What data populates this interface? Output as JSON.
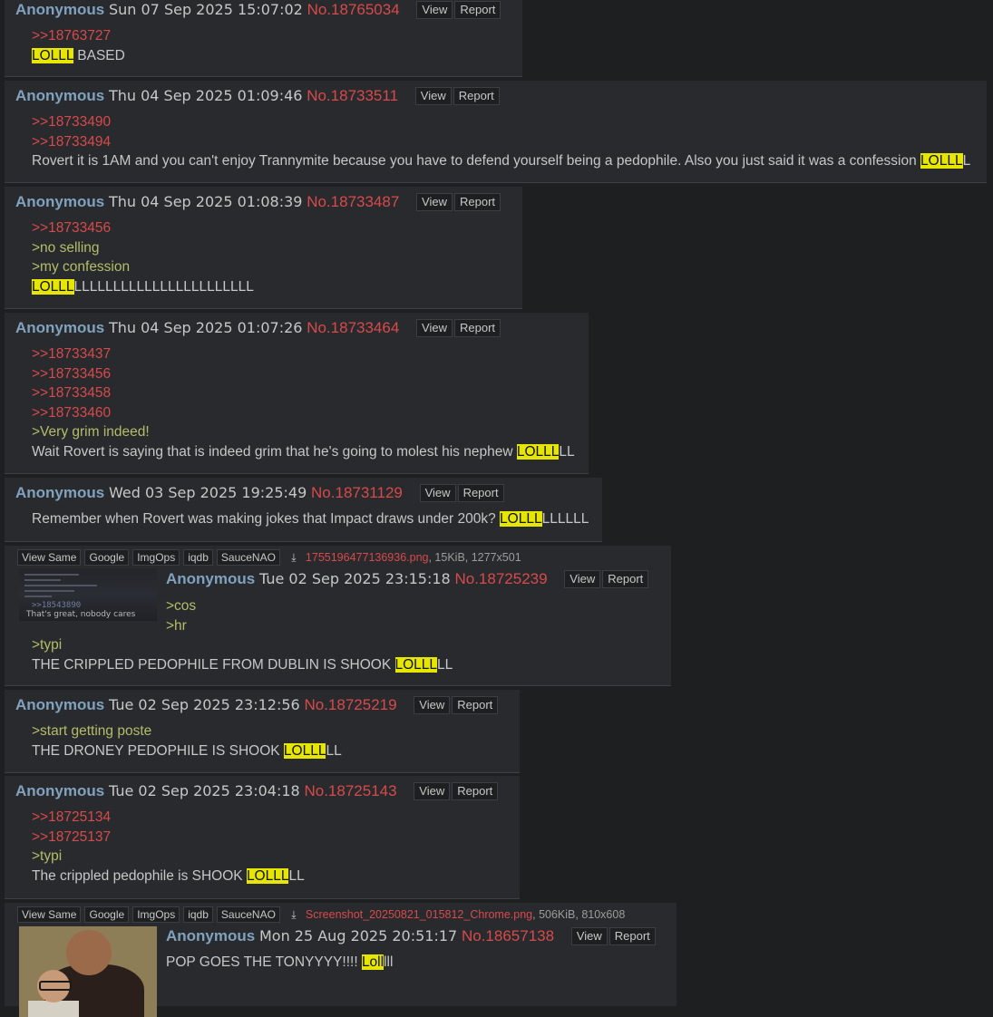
{
  "buttons": {
    "view": "View",
    "report": "Report"
  },
  "file_buttons": [
    "View Same",
    "Google",
    "ImgOps",
    "iqdb",
    "SauceNAO"
  ],
  "posts": [
    {
      "name": "Anonymous",
      "date": "Sun 07 Sep 2025 15:07:02",
      "num": "No.18765034",
      "lines": [
        ">>18763727"
      ],
      "text_pre": "",
      "hl": "LOLLL",
      "text_post": " BASED"
    },
    {
      "name": "Anonymous",
      "date": "Thu 04 Sep 2025 01:09:46",
      "num": "No.18733511",
      "lines": [
        ">>18733490",
        ">>18733494"
      ],
      "text_pre": "Rovert it is 1AM and you can't enjoy Trannymite because you have to defend yourself being a pedophile. Also you just said it was a confession ",
      "hl": "LOLLL",
      "text_post": "L"
    },
    {
      "name": "Anonymous",
      "date": "Thu 04 Sep 2025 01:08:39",
      "num": "No.18733487",
      "lines": [
        ">>18733456"
      ],
      "green": [
        ">no selling",
        ">my confession"
      ],
      "text_pre": "",
      "hl": "LOLLL",
      "text_post": "LLLLLLLLLLLLLLLLLLLLLLL"
    },
    {
      "name": "Anonymous",
      "date": "Thu 04 Sep 2025 01:07:26",
      "num": "No.18733464",
      "lines": [
        ">>18733437",
        ">>18733456",
        ">>18733458",
        ">>18733460"
      ],
      "green": [
        ">Very grim indeed!"
      ],
      "text_pre": "Wait Rovert is saying that is indeed grim that he's going to molest his nephew ",
      "hl": "LOLLL",
      "text_post": "LL"
    },
    {
      "name": "Anonymous",
      "date": "Wed 03 Sep 2025 19:25:49",
      "num": "No.18731129",
      "text_pre": "Remember when Rovert was making jokes that Impact draws under 200k? ",
      "hl": "LOLLL",
      "text_post": "LLLLLL"
    },
    {
      "name": "Anonymous",
      "date": "Tue 02 Sep 2025 23:15:18",
      "num": "No.18725239",
      "file": {
        "name": "1755196477136936.png",
        "meta": ", 15KiB, 1277x501"
      },
      "thumb_text": [
        ">>18543890",
        "That's great, nobody cares"
      ],
      "green": [
        ">cos",
        ">hr",
        ">typi"
      ],
      "text_pre": "THE CRIPPLED PEDOPHILE FROM DUBLIN IS SHOOK ",
      "hl": "LOLLL",
      "text_post": "LL"
    },
    {
      "name": "Anonymous",
      "date": "Tue 02 Sep 2025 23:12:56",
      "num": "No.18725219",
      "green": [
        ">start getting poste"
      ],
      "text_pre": "THE DRONEY PEDOPHILE IS SHOOK ",
      "hl": "LOLLL",
      "text_post": "LL"
    },
    {
      "name": "Anonymous",
      "date": "Tue 02 Sep 2025 23:04:18",
      "num": "No.18725143",
      "lines": [
        ">>18725134",
        ">>18725137"
      ],
      "green": [
        ">typi"
      ],
      "text_pre": "The crippled pedophile is SHOOK ",
      "hl": "LOLLL",
      "text_post": "LL"
    },
    {
      "name": "Anonymous",
      "date": "Mon 25 Aug 2025 20:51:17",
      "num": "No.18657138",
      "file": {
        "name": "Screenshot_20250821_015812_Chrome.png",
        "meta": ", 506KiB, 810x608"
      },
      "text_pre": "POP GOES THE TONYYYY!!!! ",
      "hl": "Loll",
      "text_post": "lll"
    }
  ]
}
